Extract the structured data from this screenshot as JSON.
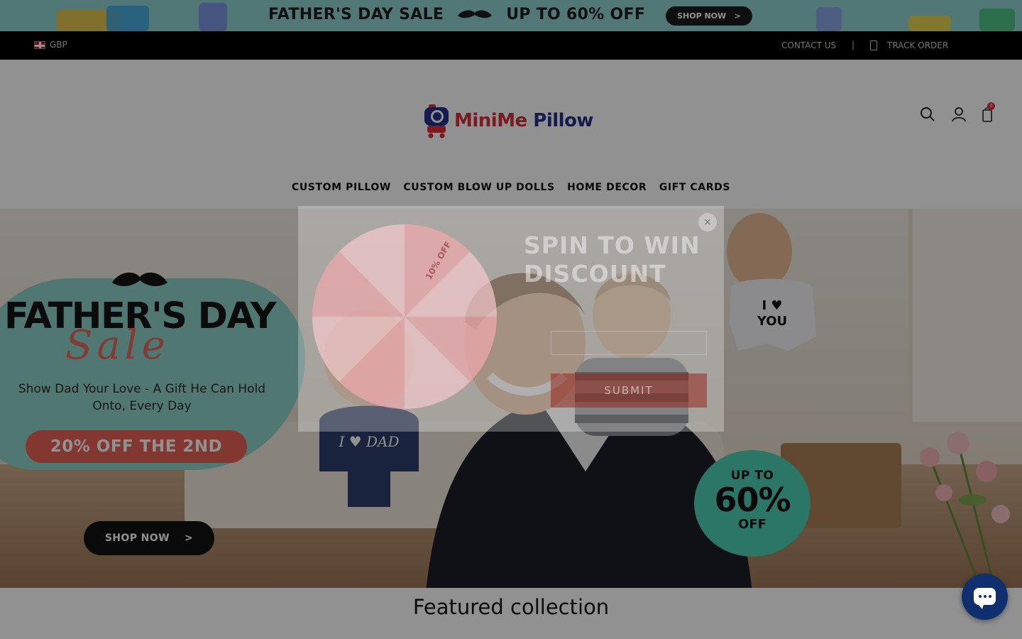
{
  "announcement": {
    "text_left": "FATHER'S DAY SALE",
    "text_right": "UP TO 60% OFF",
    "button": "SHOP NOW",
    "button_chevron": ">"
  },
  "utility_bar": {
    "currency": "GBP",
    "contact": "CONTACT US",
    "separator": "|",
    "track_order": "TRACK ORDER"
  },
  "header": {
    "logo_part1": "MiniMe",
    "logo_part2": "Pillow",
    "cart_count": "0"
  },
  "nav": {
    "items": [
      "CUSTOM PILLOW",
      "CUSTOM BLOW UP DOLLS",
      "HOME DECOR",
      "GIFT CARDS"
    ]
  },
  "hero": {
    "title": "FATHER'S DAY",
    "script": "Sale",
    "subtitle": "Show Dad Your Love - A Gift He Can Hold Onto, Every Day",
    "offer": "20% OFF THE 2ND",
    "button": "SHOP NOW",
    "button_chevron": ">",
    "badge_top": "UP TO",
    "badge_value": "60%",
    "badge_bottom": "OFF",
    "pillow_left_text": "I ♥ DAD",
    "pillow_right_line1": "I ♥",
    "pillow_right_line2": "YOU"
  },
  "popup": {
    "title_line1": "SPIN TO WIN",
    "title_line2": "DISCOUNT",
    "wheel_label": "10% OFF",
    "submit": "SUBMIT",
    "close": "×"
  },
  "featured": {
    "title": "Featured collection"
  },
  "colors": {
    "announce_bg": "#8fd3cf",
    "brand_red": "#d8303b",
    "brand_blue": "#27308a",
    "offer_red": "#e46357",
    "badge_teal": "#4ecfb7",
    "chat_blue": "#0f2f6e"
  }
}
